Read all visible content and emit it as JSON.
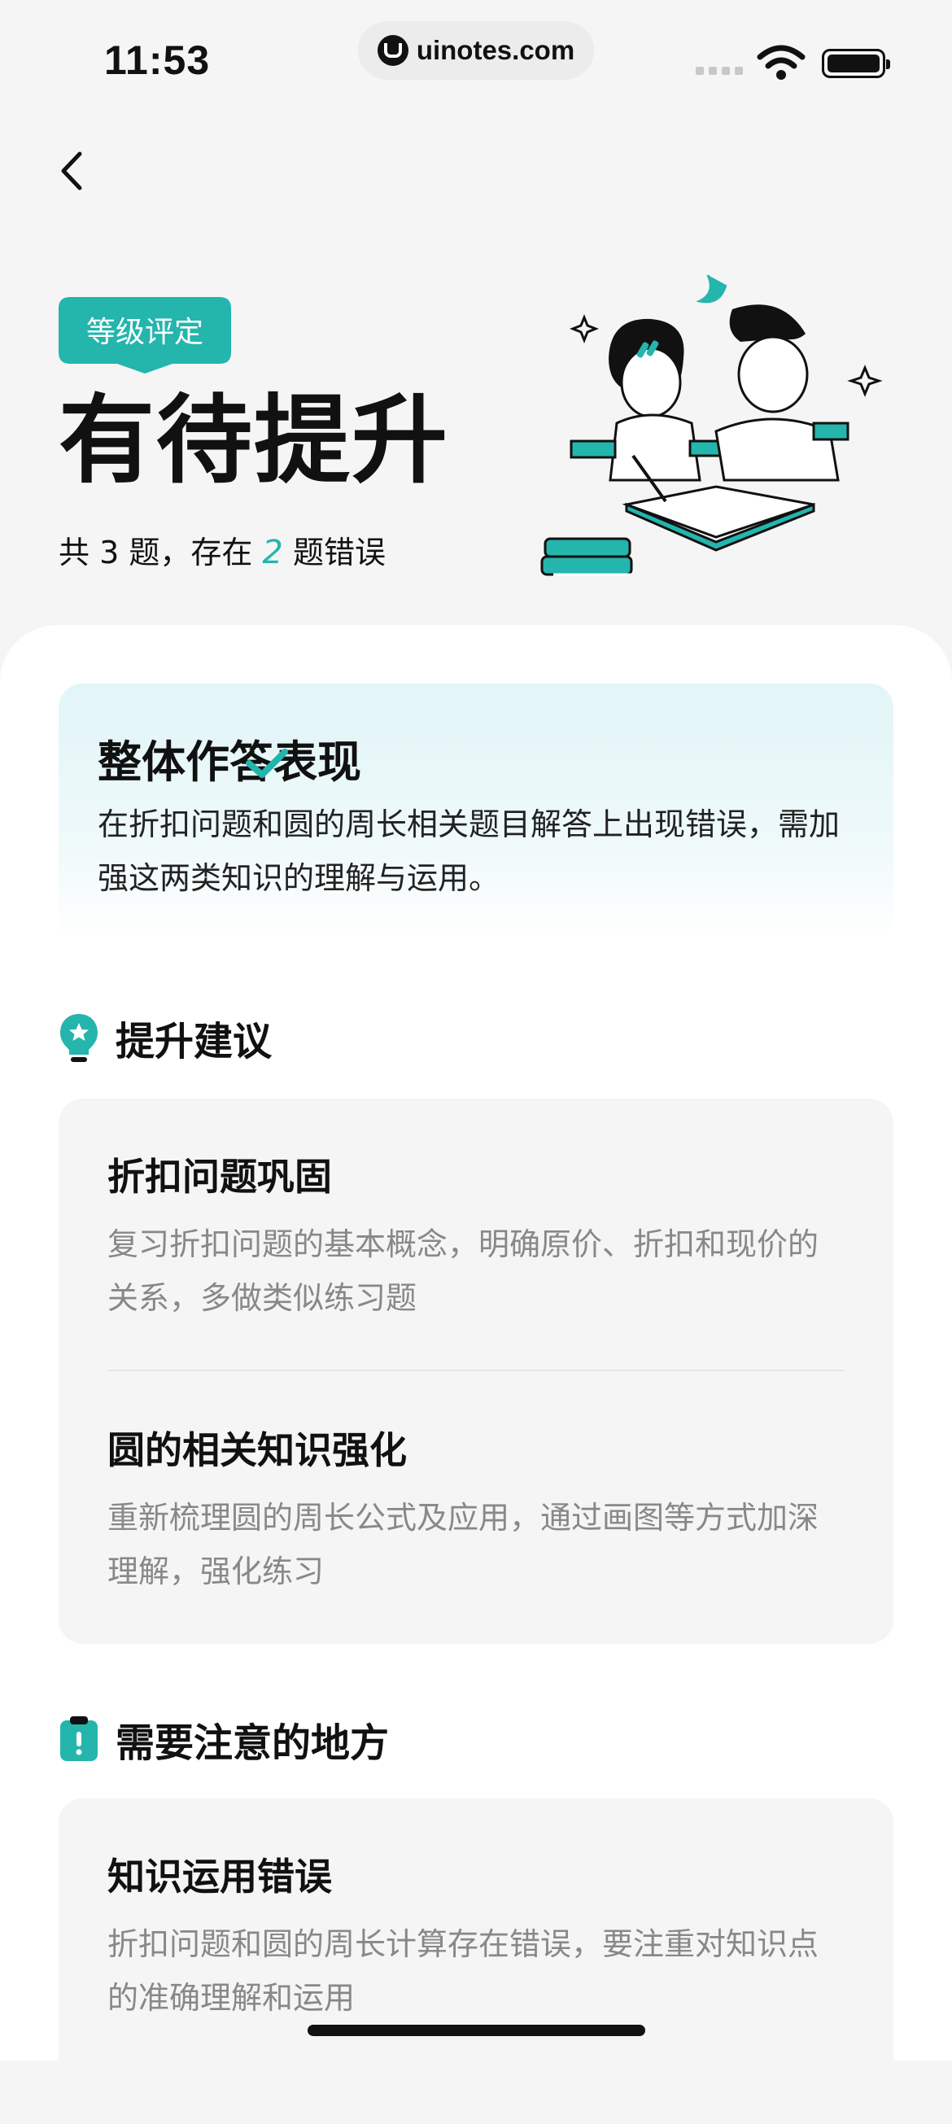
{
  "status_bar": {
    "time": "11:53",
    "url": "uinotes.com"
  },
  "header": {
    "badge": "等级评定",
    "headline": "有待提升",
    "subline_prefix": "共 3 题，存在 ",
    "subline_num": "2",
    "subline_suffix": " 题错误"
  },
  "summary": {
    "title": "整体作答表现",
    "text": "在折扣问题和圆的周长相关题目解答上出现错误，需加强这两类知识的理解与运用。"
  },
  "suggestions": {
    "title": "提升建议",
    "items": [
      {
        "title": "折扣问题巩固",
        "desc": "复习折扣问题的基本概念，明确原价、折扣和现价的关系，多做类似练习题"
      },
      {
        "title": "圆的相关知识强化",
        "desc": "重新梳理圆的周长公式及应用，通过画图等方式加深理解，强化练习"
      }
    ]
  },
  "attention": {
    "title": "需要注意的地方",
    "items": [
      {
        "title": "知识运用错误",
        "desc": "折扣问题和圆的周长计算存在错误，要注重对知识点的准确理解和运用"
      }
    ]
  },
  "colors": {
    "accent": "#24b5ad",
    "background": "#f5f5f5",
    "card": "#f5f5f5",
    "text": "#111111",
    "muted": "#888888"
  },
  "icons": [
    "back-arrow-icon",
    "wifi-icon",
    "battery-icon",
    "lightbulb-star-icon",
    "clipboard-alert-icon"
  ]
}
